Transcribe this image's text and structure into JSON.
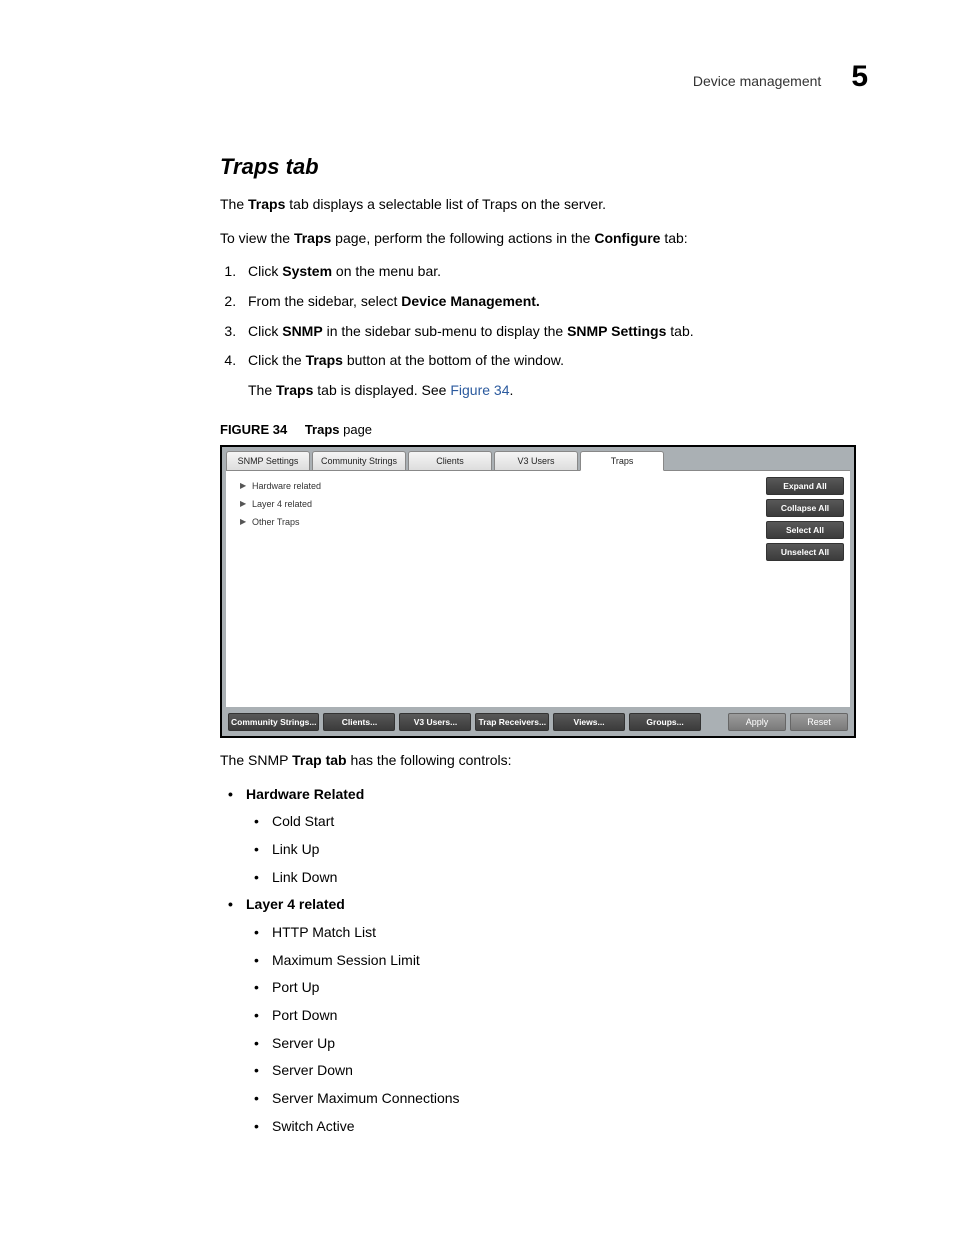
{
  "header": {
    "section": "Device management",
    "chapter_number": "5"
  },
  "section_title": "Traps tab",
  "para_intro_before_bold": "The ",
  "para_intro_bold": "Traps",
  "para_intro_after_bold": " tab displays a selectable list of Traps on the server.",
  "para_view_1": "To view the ",
  "para_view_bold1": "Traps",
  "para_view_2": " page, perform the following actions in the ",
  "para_view_bold2": "Configure",
  "para_view_3": " tab:",
  "steps": {
    "s1_a": "Click ",
    "s1_b": "System",
    "s1_c": " on the menu bar.",
    "s2_a": "From the sidebar, select ",
    "s2_b": "Device Management.",
    "s3_a": "Click ",
    "s3_b": "SNMP",
    "s3_c": " in the sidebar sub-menu to display the ",
    "s3_d": "SNMP Settings",
    "s3_e": " tab.",
    "s4_a": "Click the ",
    "s4_b": "Traps",
    "s4_c": " button at the bottom of the window.",
    "s4_sub_a": "The ",
    "s4_sub_b": "Traps",
    "s4_sub_c": " tab is displayed. See ",
    "s4_sub_link": "Figure 34",
    "s4_sub_d": "."
  },
  "figure": {
    "label": "FIGURE 34",
    "title_bold": "Traps",
    "title_rest": " page"
  },
  "app": {
    "tabs": {
      "t0": "SNMP Settings",
      "t1": "Community Strings",
      "t2": "Clients",
      "t3": "V3 Users",
      "t4": "Traps"
    },
    "tree": {
      "r0": "Hardware related",
      "r1": "Layer 4 related",
      "r2": "Other Traps"
    },
    "side": {
      "b0": "Expand All",
      "b1": "Collapse All",
      "b2": "Select All",
      "b3": "Unselect All"
    },
    "bottom": {
      "b0": "Community Strings...",
      "b1": "Clients...",
      "b2": "V3 Users...",
      "b3": "Trap Receivers...",
      "b4": "Views...",
      "b5": "Groups...",
      "apply": "Apply",
      "reset": "Reset"
    }
  },
  "after_fig_a": "The SNMP ",
  "after_fig_b": "Trap tab",
  "after_fig_c": " has the following controls:",
  "bullets": {
    "hw_title": "Hardware Related",
    "hw": {
      "i0": "Cold Start",
      "i1": "Link Up",
      "i2": "Link Down"
    },
    "l4_title": "Layer 4 related",
    "l4": {
      "i0": "HTTP Match List",
      "i1": "Maximum Session Limit",
      "i2": "Port Up",
      "i3": "Port Down",
      "i4": "Server Up",
      "i5": "Server Down",
      "i6": "Server Maximum Connections",
      "i7": "Switch Active"
    }
  }
}
